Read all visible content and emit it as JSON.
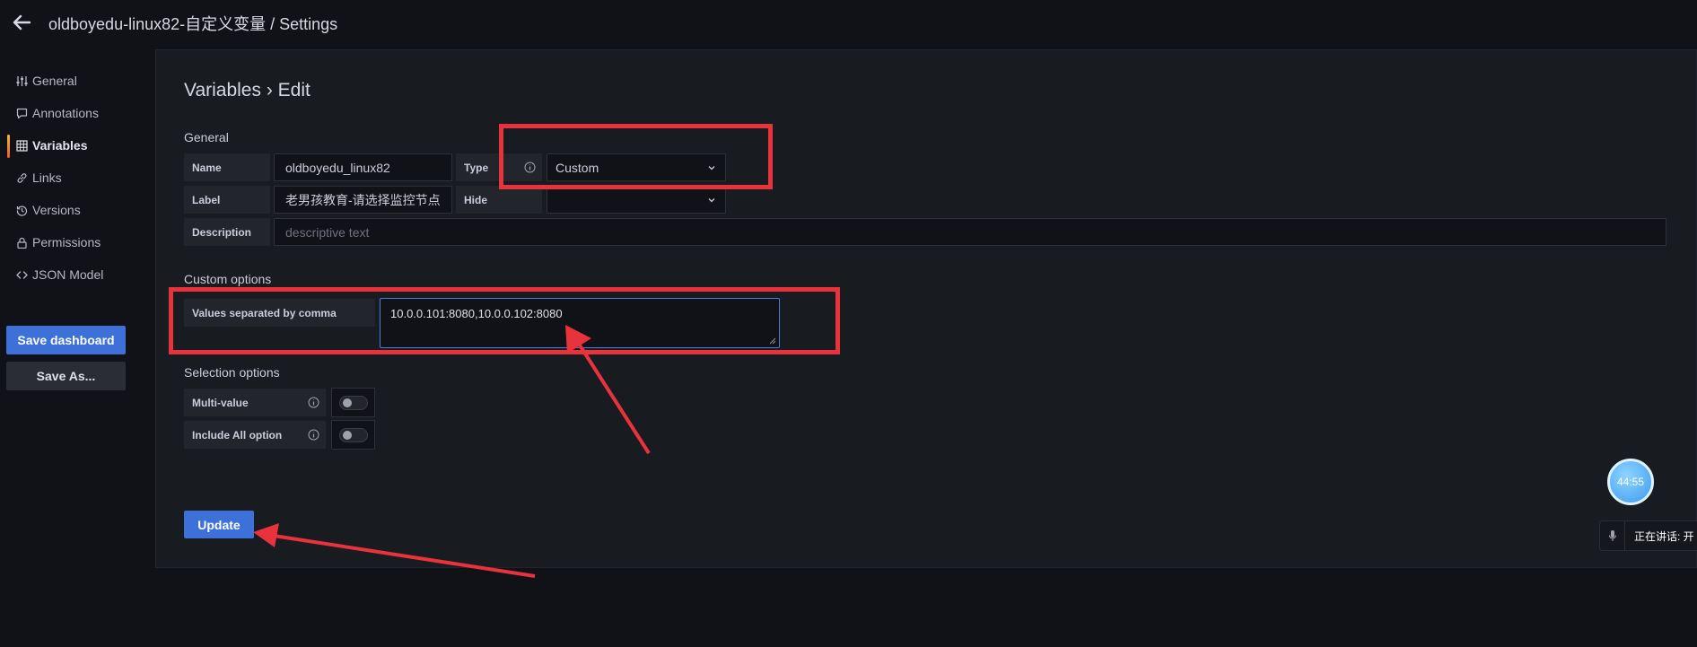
{
  "header": {
    "title": "oldboyedu-linux82-自定义变量 / Settings"
  },
  "sidebar": {
    "items": [
      {
        "label": "General",
        "icon": "sliders-icon",
        "active": false
      },
      {
        "label": "Annotations",
        "icon": "comment-icon",
        "active": false
      },
      {
        "label": "Variables",
        "icon": "table-icon",
        "active": true
      },
      {
        "label": "Links",
        "icon": "link-icon",
        "active": false
      },
      {
        "label": "Versions",
        "icon": "history-icon",
        "active": false
      },
      {
        "label": "Permissions",
        "icon": "lock-icon",
        "active": false
      },
      {
        "label": "JSON Model",
        "icon": "code-icon",
        "active": false
      }
    ],
    "save_dashboard": "Save dashboard",
    "save_as": "Save As..."
  },
  "main": {
    "heading": "Variables › Edit",
    "general": {
      "section": "General",
      "name_label": "Name",
      "name_value": "oldboyedu_linux82",
      "type_label": "Type",
      "type_value": "Custom",
      "label_label": "Label",
      "label_value": "老男孩教育-请选择监控节点",
      "hide_label": "Hide",
      "hide_value": "",
      "description_label": "Description",
      "description_placeholder": "descriptive text"
    },
    "custom_options": {
      "section": "Custom options",
      "values_label": "Values separated by comma",
      "values_value": "10.0.0.101:8080,10.0.0.102:8080"
    },
    "selection_options": {
      "section": "Selection options",
      "multi_value_label": "Multi-value",
      "multi_value_on": false,
      "include_all_label": "Include All option",
      "include_all_on": false
    },
    "update_button": "Update"
  },
  "overlay": {
    "timer": "44:55",
    "speaking": "正在讲话: 开"
  },
  "colors": {
    "accent": "#3d71d9",
    "annotation_red": "#e8323c",
    "background": "#111217",
    "panel": "#181b1f"
  }
}
